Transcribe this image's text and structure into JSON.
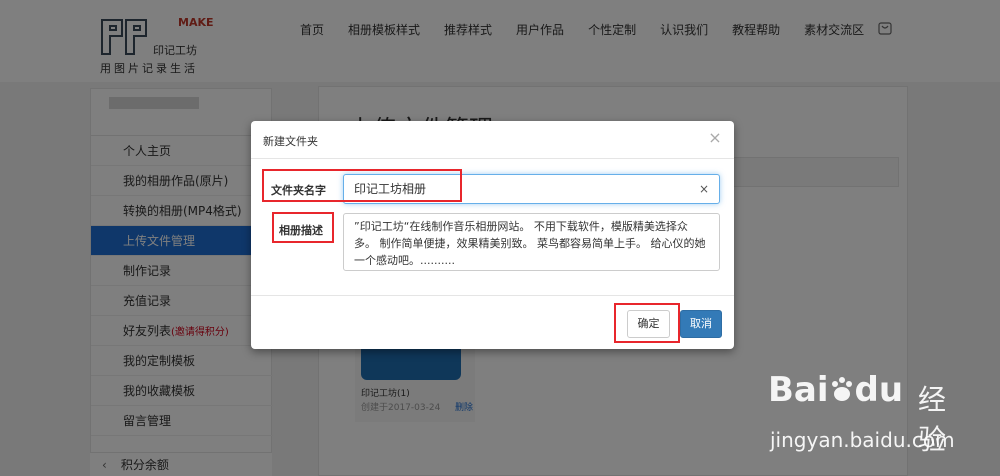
{
  "header": {
    "logo_make": "MAKE",
    "logo_brand": "印记工坊",
    "logo_slogan": "用图片记录生活",
    "nav": [
      "首页",
      "相册模板样式",
      "推荐样式",
      "用户作品",
      "个性定制",
      "认识我们",
      "教程帮助",
      "素材交流区"
    ]
  },
  "sidebar": {
    "items": [
      {
        "label": "个人主页"
      },
      {
        "label": "我的相册作品(原片)"
      },
      {
        "label": "转换的相册(MP4格式)"
      },
      {
        "label": "上传文件管理",
        "active": true
      },
      {
        "label": "制作记录"
      },
      {
        "label": "充值记录"
      },
      {
        "label": "好友列表",
        "extra": "(邀请得积分)"
      },
      {
        "label": "我的定制模板"
      },
      {
        "label": "我的收藏模板"
      },
      {
        "label": "留言管理"
      }
    ],
    "bottom_label": "积分余额"
  },
  "main": {
    "title": "上传文件管理",
    "album": {
      "name": "印记工坊(1)",
      "date": "创建于2017-03-24",
      "delete": "删除"
    }
  },
  "modal": {
    "title": "新建文件夹",
    "name_label": "文件夹名字",
    "name_value": "印记工坊相册",
    "desc_label": "相册描述",
    "desc_value": "”印记工坊“在线制作音乐相册网站。 不用下载软件，模版精美选择众多。 制作简单便捷，效果精美别致。 菜鸟都容易简单上手。 给心仪的她一个感动吧。..........",
    "ok_label": "确定",
    "cancel_label": "取消"
  },
  "watermark": {
    "brand": "Bai",
    "brand2": "du",
    "jingyan": "经验",
    "url": "jingyan.baidu.com"
  },
  "colors": {
    "accent": "#1e6fd4",
    "primary_button": "#337ab7",
    "highlight": "#e8262c"
  }
}
